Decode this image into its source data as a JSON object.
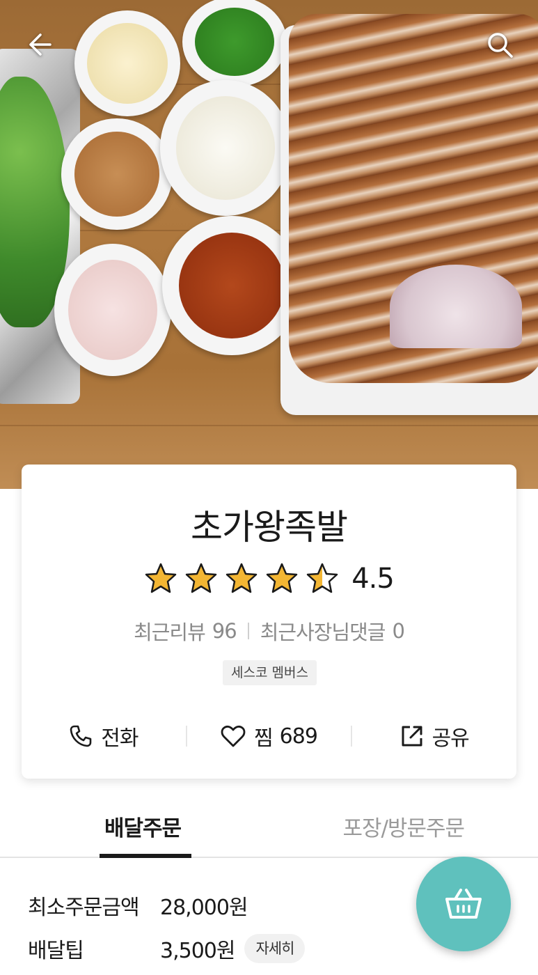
{
  "header": {
    "back_icon": "arrow-left-icon",
    "search_icon": "search-icon"
  },
  "store": {
    "name": "초가왕족발",
    "rating": "4.5",
    "stars": 4.5,
    "recent_reviews_label": "최근리뷰",
    "recent_reviews_count": "96",
    "owner_replies_label": "최근사장님댓글",
    "owner_replies_count": "0",
    "badge": "세스코 멤버스",
    "star_color": "#f3b633"
  },
  "actions": {
    "call_label": "전화",
    "like_label": "찜",
    "like_count": "689",
    "share_label": "공유"
  },
  "tabs": [
    {
      "label": "배달주문",
      "active": true
    },
    {
      "label": "포장/방문주문",
      "active": false
    }
  ],
  "delivery": {
    "min_order_label": "최소주문금액",
    "min_order_value": "28,000원",
    "tip_label": "배달팁",
    "tip_value": "3,500원",
    "detail_button": "자세히"
  },
  "cart": {
    "icon": "basket-icon",
    "color": "#5fc1bd"
  }
}
